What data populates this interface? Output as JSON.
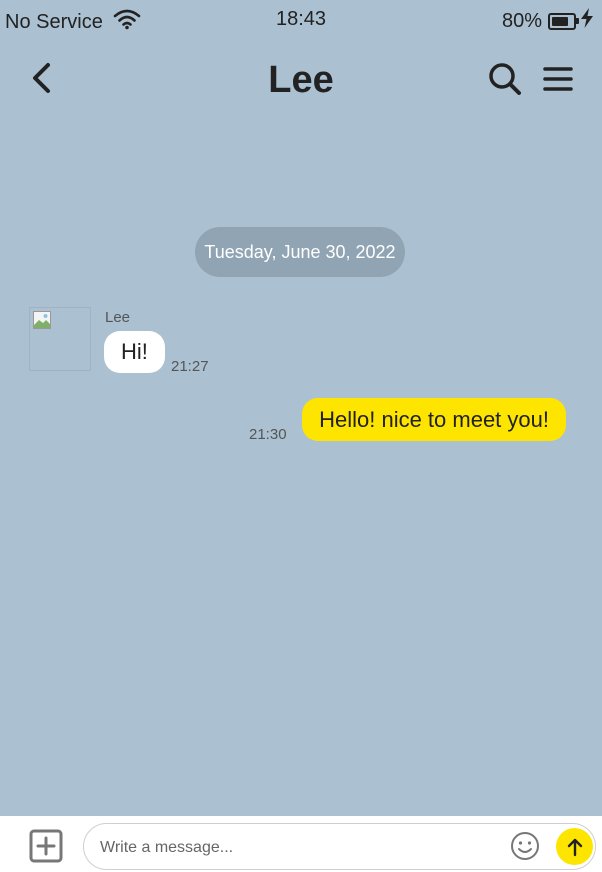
{
  "status_bar": {
    "carrier": "No Service",
    "time": "18:43",
    "battery_percent": "80%",
    "battery_level": 0.8,
    "icons": [
      "wifi-icon",
      "battery-icon",
      "charging-bolt-icon"
    ]
  },
  "header": {
    "title": "Lee",
    "icons": [
      "back-chevron-icon",
      "search-icon",
      "hamburger-menu-icon"
    ]
  },
  "conversation": {
    "date_divider": "Tuesday, June 30, 2022",
    "messages": [
      {
        "direction": "incoming",
        "sender": "Lee",
        "text": "Hi!",
        "time": "21:27"
      },
      {
        "direction": "outgoing",
        "text": "Hello! nice to meet you!",
        "time": "21:30"
      }
    ]
  },
  "composer": {
    "placeholder": "Write a message...",
    "value": "",
    "icons": [
      "add-plus-icon",
      "emoji-smile-icon",
      "send-arrow-up-icon"
    ]
  },
  "colors": {
    "chat_background": "#abc1d1",
    "outgoing_bubble": "#fee500",
    "incoming_bubble": "#ffffff",
    "date_pill": "#90a4b3",
    "send_button": "#fee500"
  }
}
